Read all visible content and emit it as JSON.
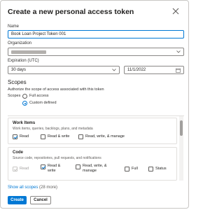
{
  "dialog": {
    "title": "Create a new personal access token",
    "close_icon": "close-icon"
  },
  "name": {
    "label": "Name",
    "value": "Book Loan Project Token 001"
  },
  "organization": {
    "label": "Organization",
    "value_redacted": true
  },
  "expiration": {
    "label": "Expiration (UTC)",
    "option": "30 days",
    "date": "11/1/2022"
  },
  "scopes": {
    "title": "Scopes",
    "description": "Authorize the scope of access associated with this token",
    "radio_label": "Scopes",
    "full_access": "Full access",
    "custom_defined": "Custom defined",
    "selected": "custom_defined"
  },
  "scope_cards": [
    {
      "title": "Work Items",
      "description": "Work items, queries, backlogs, plans, and metadata",
      "options": [
        {
          "label": "Read",
          "checked": true,
          "disabled": false
        },
        {
          "label": "Read & write",
          "checked": false,
          "disabled": false
        },
        {
          "label": "Read, write, & manage",
          "checked": false,
          "disabled": false
        }
      ]
    },
    {
      "title": "Code",
      "description": "Source code, repositories, pull requests, and notifications",
      "options": [
        {
          "label": "Read",
          "checked": true,
          "disabled": true
        },
        {
          "label": "Read & write",
          "checked": true,
          "disabled": false
        },
        {
          "label": "Read, write, & manage",
          "checked": false,
          "disabled": false
        },
        {
          "label": "Full",
          "checked": false,
          "disabled": false
        },
        {
          "label": "Status",
          "checked": false,
          "disabled": false
        }
      ]
    }
  ],
  "footer": {
    "show_all_scopes": "Show all scopes",
    "more_count": "(28 more)",
    "create_label": "Create",
    "cancel_label": "Cancel"
  },
  "colors": {
    "accent": "#0078d4",
    "border": "#8a8886"
  }
}
